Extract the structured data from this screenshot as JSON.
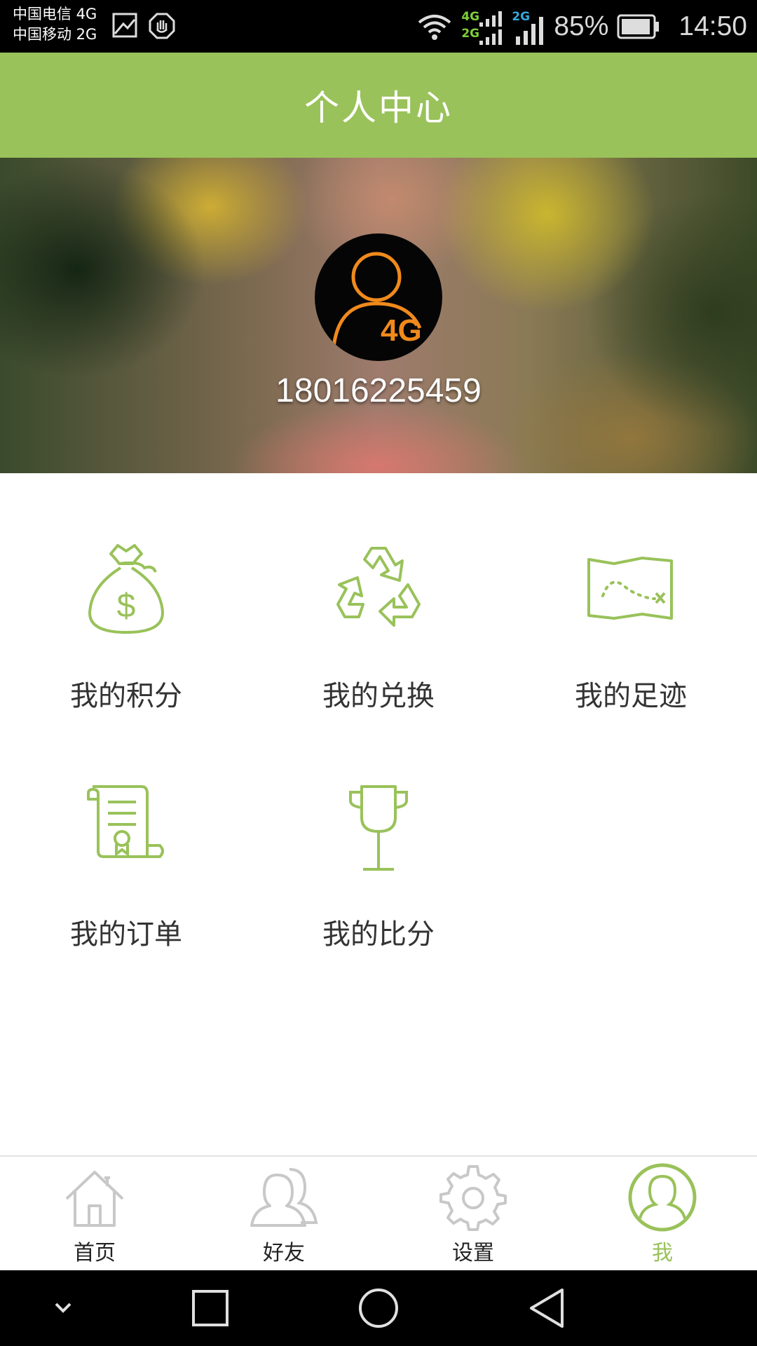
{
  "status_bar": {
    "carrier_1": "中国电信 4G",
    "carrier_2": "中国移动 2G",
    "signal_1_label_top": "4G",
    "signal_1_label_bottom": "2G",
    "signal_2_label": "2G",
    "battery_percent": "85%",
    "time": "14:50",
    "icons": [
      "image-icon",
      "hand-stop-icon",
      "wifi-icon",
      "signal-icon",
      "battery-icon"
    ]
  },
  "header": {
    "title": "个人中心",
    "background": "#99c25a"
  },
  "profile": {
    "avatar_badge": "4G",
    "phone": "18016225459",
    "avatar_accent": "#f08a1c"
  },
  "menu": {
    "accent": "#99c25a",
    "items": [
      {
        "label": "我的积分",
        "icon": "money-bag-icon"
      },
      {
        "label": "我的兑换",
        "icon": "recycle-icon"
      },
      {
        "label": "我的足迹",
        "icon": "treasure-map-icon"
      },
      {
        "label": "我的订单",
        "icon": "scroll-certificate-icon"
      },
      {
        "label": "我的比分",
        "icon": "trophy-cup-icon"
      }
    ]
  },
  "bottom_nav": {
    "active_index": 3,
    "tabs": [
      {
        "label": "首页",
        "icon": "home-icon"
      },
      {
        "label": "好友",
        "icon": "friends-icon"
      },
      {
        "label": "设置",
        "icon": "gear-icon"
      },
      {
        "label": "我",
        "icon": "user-icon"
      }
    ]
  },
  "system_nav": {
    "icons": [
      "chevron-down-icon",
      "recent-apps-icon",
      "home-circle-icon",
      "back-triangle-icon"
    ]
  }
}
